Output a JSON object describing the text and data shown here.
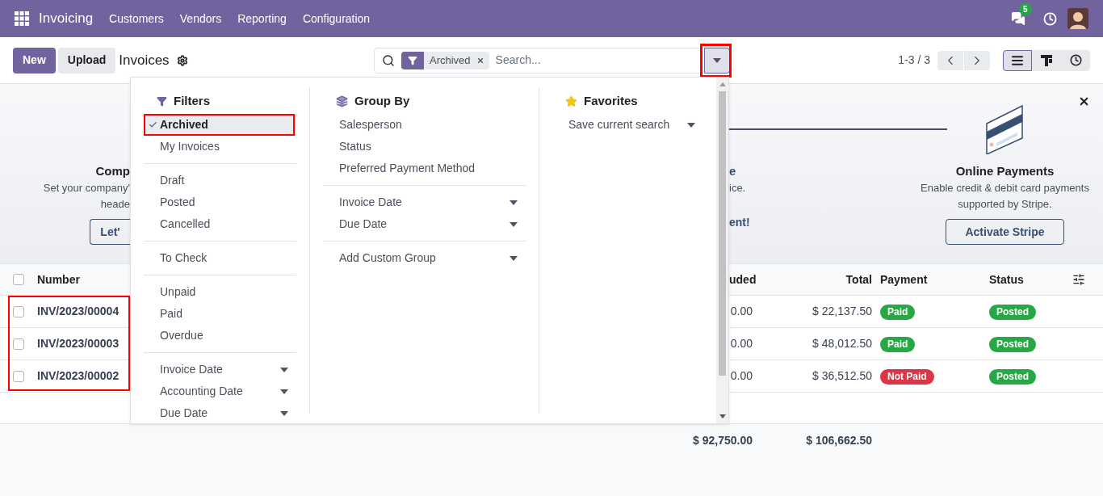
{
  "navbar": {
    "app": "Invoicing",
    "menu": [
      "Customers",
      "Vendors",
      "Reporting",
      "Configuration"
    ],
    "messages_badge": "5"
  },
  "control_panel": {
    "buttons": [
      "New",
      "Upload"
    ],
    "title": "Invoices",
    "search": {
      "facets": [
        "Archived"
      ],
      "placeholder": "Search..."
    },
    "pager": "1-3 / 3",
    "views": [
      {
        "kind": "list",
        "selected": true
      },
      {
        "kind": "kanban",
        "selected": false
      },
      {
        "kind": "activity",
        "selected": false
      }
    ]
  },
  "search_panel": {
    "filters": {
      "title": "Filters",
      "groups": [
        {
          "items": [
            {
              "label": "Archived",
              "kind": "option",
              "selected": true
            },
            {
              "label": "My Invoices",
              "kind": "option",
              "selected": false
            }
          ]
        },
        {
          "items": [
            {
              "label": "Draft",
              "kind": "option",
              "selected": false
            },
            {
              "label": "Posted",
              "kind": "option",
              "selected": false
            },
            {
              "label": "Cancelled",
              "kind": "option",
              "selected": false
            }
          ]
        },
        {
          "items": [
            {
              "label": "To Check",
              "kind": "option",
              "selected": false
            }
          ]
        },
        {
          "items": [
            {
              "label": "Unpaid",
              "kind": "option",
              "selected": false
            },
            {
              "label": "Paid",
              "kind": "option",
              "selected": false
            },
            {
              "label": "Overdue",
              "kind": "option",
              "selected": false
            }
          ]
        },
        {
          "items": [
            {
              "label": "Invoice Date",
              "kind": "submenu",
              "selected": false
            },
            {
              "label": "Accounting Date",
              "kind": "submenu",
              "selected": false
            },
            {
              "label": "Due Date",
              "kind": "submenu",
              "selected": false
            }
          ]
        }
      ]
    },
    "group_by": {
      "title": "Group By",
      "groups": [
        {
          "items": [
            {
              "label": "Salesperson",
              "kind": "option",
              "selected": false
            },
            {
              "label": "Status",
              "kind": "option",
              "selected": false
            },
            {
              "label": "Preferred Payment Method",
              "kind": "option",
              "selected": false
            }
          ]
        },
        {
          "items": [
            {
              "label": "Invoice Date",
              "kind": "submenu",
              "selected": false
            },
            {
              "label": "Due Date",
              "kind": "submenu",
              "selected": false
            }
          ]
        },
        {
          "items": [
            {
              "label": "Add Custom Group",
              "kind": "submenu",
              "selected": false
            }
          ]
        }
      ]
    },
    "favorites": {
      "title": "Favorites",
      "groups": [
        {
          "items": [
            {
              "label": "Save current search",
              "kind": "submenu",
              "selected": false
            }
          ]
        }
      ]
    }
  },
  "banner": {
    "left": {
      "title": "Comp",
      "lines": [
        "Set your company'",
        "heade"
      ],
      "button": "Let'"
    },
    "middle": {
      "title": "e",
      "lines": [
        "ice."
      ],
      "button": "ent!"
    },
    "right": {
      "title": "Online Payments",
      "lines": [
        "Enable credit & debit card payments",
        "supported by Stripe."
      ],
      "button": "Activate Stripe"
    }
  },
  "table": {
    "select_all": {
      "checked": false
    },
    "columns": [
      "Number",
      "uded",
      "Total",
      "Payment",
      "Status"
    ],
    "rows": [
      {
        "checked": false,
        "number": "INV/2023/00004",
        "column_2": "0.00",
        "total": "$ 22,137.50",
        "payment": {
          "label": "Paid",
          "color": "#28a745"
        },
        "status": {
          "label": "Posted",
          "color": "#28a745"
        }
      },
      {
        "checked": false,
        "number": "INV/2023/00003",
        "column_2": "0.00",
        "total": "$ 48,012.50",
        "payment": {
          "label": "Paid",
          "color": "#28a745"
        },
        "status": {
          "label": "Posted",
          "color": "#28a745"
        }
      },
      {
        "checked": false,
        "number": "INV/2023/00002",
        "column_2": "0.00",
        "total": "$ 36,512.50",
        "payment": {
          "label": "Not Paid",
          "color": "#dc3545"
        },
        "status": {
          "label": "Posted",
          "color": "#28a745"
        }
      }
    ],
    "totals": [
      "$ 92,750.00",
      "$ 106,662.50"
    ]
  }
}
